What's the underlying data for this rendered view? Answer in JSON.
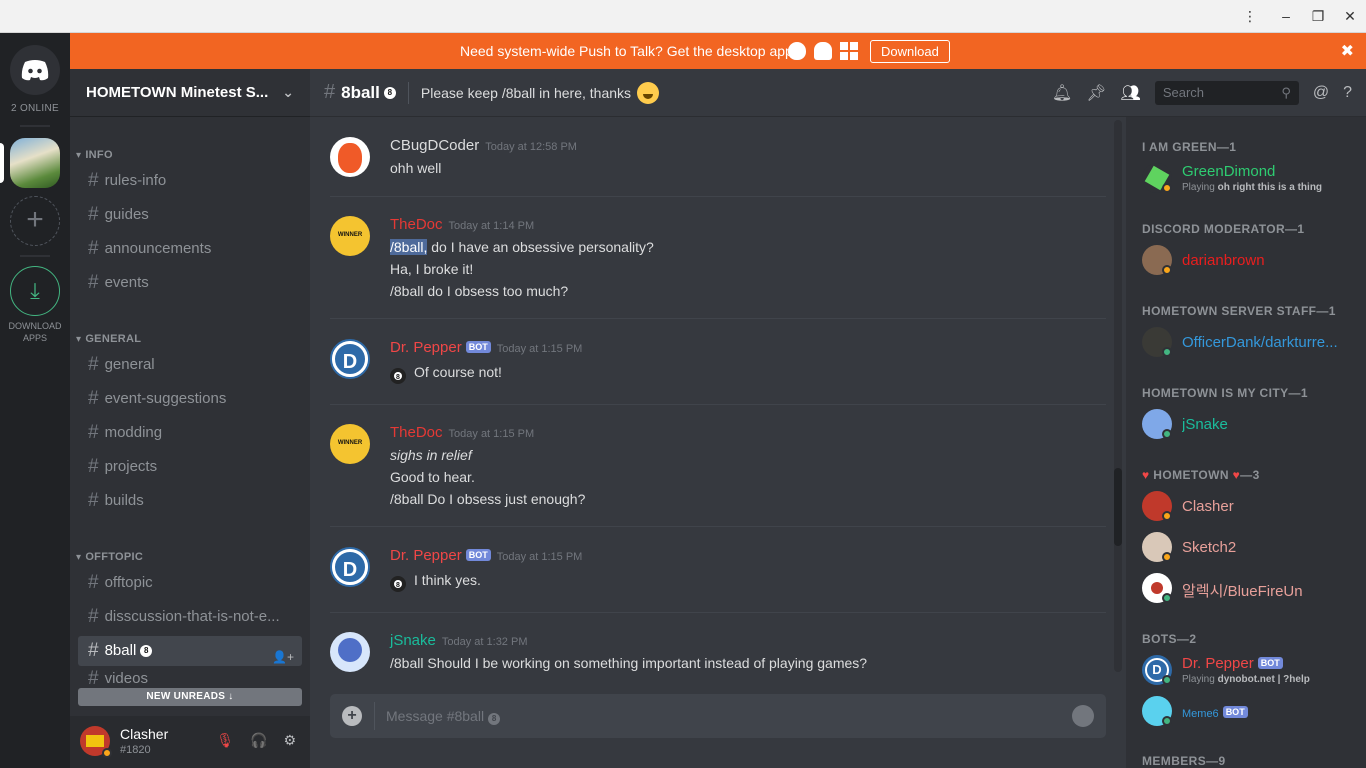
{
  "banner": {
    "text": "Need system-wide Push to Talk? Get the desktop app!",
    "download_label": "Download",
    "close_glyph": "✖"
  },
  "guilds": {
    "online_label": "2 ONLINE",
    "download_apps_label": "DOWNLOAD APPS",
    "add_glyph": "+",
    "download_glyph": "⤓"
  },
  "server": {
    "name": "HOMETOWN Minetest S...",
    "categories": {
      "info": "INFO",
      "general": "GENERAL",
      "offtopic": "OFFTOPIC"
    },
    "channels": [
      "rules-info",
      "guides",
      "announcements",
      "events",
      "general",
      "event-suggestions",
      "modding",
      "projects",
      "builds",
      "offtopic",
      "disscussion-that-is-not-e...",
      "8ball",
      "videos"
    ],
    "new_unreads": "NEW UNREADS ↓"
  },
  "user": {
    "name": "Clasher",
    "tag": "#1820"
  },
  "channel": {
    "name": "8ball",
    "topic": "Please keep /8ball in here, thanks",
    "search_placeholder": "Search",
    "composer_placeholder": "Message #8ball"
  },
  "messages": [
    {
      "author": "CBugDCoder",
      "color": "#dcddde",
      "time": "Today at 12:58 PM",
      "lines": [
        "ohh well"
      ]
    },
    {
      "author": "TheDoc",
      "color": "#e53935",
      "time": "Today at 1:14 PM",
      "highlight": "/8ball,",
      "lines": [
        " do I have an obsessive personality?",
        "Ha, I broke it!",
        "/8ball do I obsess too much?"
      ]
    },
    {
      "author": "Dr. Pepper",
      "color": "#f04747",
      "bot": "BOT",
      "time": "Today at 1:15 PM",
      "lines": [
        "Of course not!"
      ]
    },
    {
      "author": "TheDoc",
      "color": "#e53935",
      "time": "Today at 1:15 PM",
      "lines": [
        "sighs in relief",
        "Good to hear.",
        "/8ball Do I obsess just enough?"
      ]
    },
    {
      "author": "Dr. Pepper",
      "color": "#f04747",
      "bot": "BOT",
      "time": "Today at 1:15 PM",
      "lines": [
        "I think yes."
      ]
    },
    {
      "author": "jSnake",
      "color": "#1abc9c",
      "time": "Today at 1:32 PM",
      "lines": [
        "/8ball Should I be working on something important instead of playing games?"
      ]
    }
  ],
  "members": {
    "roles": [
      "I AM GREEN—1",
      "DISCORD MODERATOR—1",
      "HOMETOWN SERVER STAFF—1",
      "HOMETOWN IS MY CITY—1",
      "HOMETOWN",
      "—3",
      "BOTS—2",
      "MEMBERS—9"
    ],
    "list": [
      {
        "name": "GreenDimond",
        "color": "#2ecc71",
        "playing_prefix": "Playing",
        "playing": "oh right this is a thing"
      },
      {
        "name": "darianbrown",
        "color": "#e91e1e"
      },
      {
        "name": "OfficerDank/darkturre...",
        "color": "#3498db"
      },
      {
        "name": "jSnake",
        "color": "#1abc9c"
      },
      {
        "name": "Clasher",
        "color": "#e8a09a"
      },
      {
        "name": "Sketch2",
        "color": "#e8a09a"
      },
      {
        "name": "알렉시/BlueFireUn",
        "color": "#e8a09a"
      },
      {
        "name": "Dr. Pepper",
        "color": "#f04747",
        "bot": "BOT",
        "playing_prefix": "Playing",
        "playing": "dynobot.net | ?help"
      },
      {
        "name": "Meme6",
        "color": "#3498db",
        "bot": "BOT"
      }
    ]
  },
  "icons": {
    "bell": "bell-icon",
    "pin": "pin-icon",
    "members": "members-icon",
    "mention": "mention-icon",
    "help": "help-icon"
  }
}
